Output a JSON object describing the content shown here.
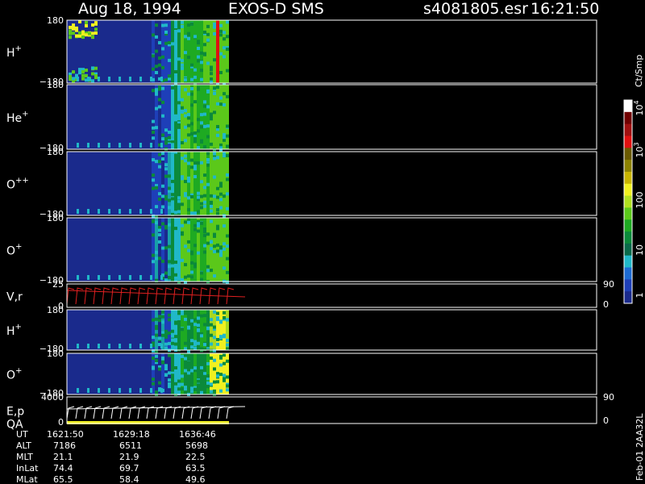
{
  "header": {
    "date": "Aug 18, 1994",
    "instrument": "EXOS-D SMS",
    "file": "s4081805.esr",
    "time": "16:21:50"
  },
  "panels": [
    {
      "label": "H",
      "sup": "+",
      "top": "180",
      "bottom": "−180"
    },
    {
      "label": "He",
      "sup": "+",
      "top": "180",
      "bottom": "−180"
    },
    {
      "label": "O",
      "sup": "++",
      "top": "180",
      "bottom": "−180"
    },
    {
      "label": "O",
      "sup": "+",
      "top": "180",
      "bottom": "−180"
    },
    {
      "label": "V,r",
      "sup": "",
      "top": "25",
      "bottom": "0",
      "right_top": "90",
      "right_bottom": "0"
    },
    {
      "label": "H",
      "sup": "+",
      "top": "180",
      "bottom": "−180"
    },
    {
      "label": "O",
      "sup": "+",
      "top": "180",
      "bottom": "−180"
    },
    {
      "label": "E,p",
      "label2": "QA",
      "sup": "",
      "top": "4000",
      "bottom": "0",
      "right_top": "90",
      "right_bottom": "0"
    }
  ],
  "colorbar": {
    "unit": "Ct/Smp",
    "ticks": [
      {
        "base": "1",
        "exp": ""
      },
      {
        "base": "10",
        "exp": ""
      },
      {
        "base": "100",
        "exp": ""
      },
      {
        "base": "10",
        "exp": "3"
      },
      {
        "base": "10",
        "exp": "4"
      }
    ],
    "colors": [
      "#1a2a8c",
      "#1e3fb8",
      "#1c6ad2",
      "#20b8c8",
      "#0a6a4a",
      "#0b8a3a",
      "#1eaa22",
      "#5bc81a",
      "#b0e020",
      "#f0f020",
      "#c8b400",
      "#8c8200",
      "#6a5a00",
      "#e01010",
      "#a01010",
      "#700000",
      "#ffffff"
    ]
  },
  "footer": {
    "rows": [
      {
        "name": "UT",
        "values": [
          "1621:50",
          "1629:18",
          "1636:46"
        ]
      },
      {
        "name": "ALT",
        "values": [
          "7186",
          "6511",
          "5698"
        ]
      },
      {
        "name": "MLT",
        "values": [
          "21.1",
          "21.9",
          "22.5"
        ]
      },
      {
        "name": "InLat",
        "values": [
          "74.4",
          "69.7",
          "63.5"
        ]
      },
      {
        "name": "MLat",
        "values": [
          "65.5",
          "58.4",
          "49.6"
        ]
      }
    ],
    "side_label": "Feb-01 2AA32L"
  },
  "chart_data": {
    "type": "heatmap",
    "title": "Aug 18, 1994   EXOS-D SMS",
    "colorbar_unit": "Ct/Smp",
    "colorbar_scale": "log",
    "colorbar_range": [
      1,
      10000
    ],
    "time_ticks": [
      "1621:50",
      "1629:18",
      "1636:46"
    ],
    "panels": [
      "H+",
      "He+",
      "O++",
      "O+",
      "V,r",
      "H+",
      "O+",
      "E,p QA"
    ],
    "y_range_angle": [
      -180,
      180
    ],
    "y_range_vr": [
      0,
      25
    ],
    "y_range_ep": [
      0,
      4000
    ]
  }
}
